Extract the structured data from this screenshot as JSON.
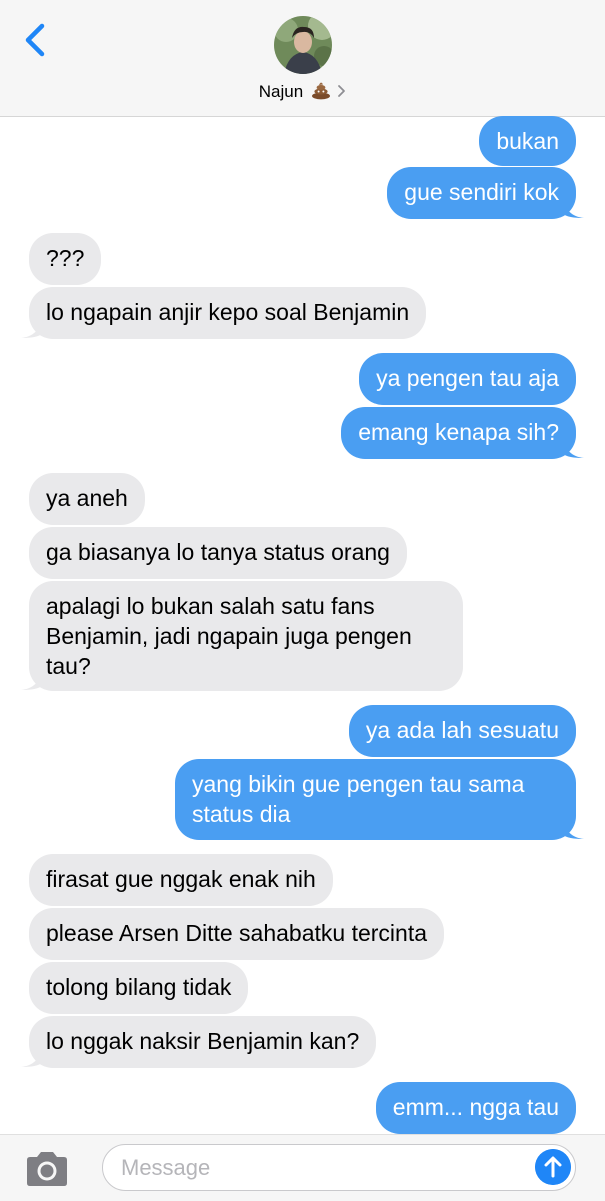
{
  "header": {
    "contact_name": "Najun",
    "contact_emoji": "pile-of-poo-icon"
  },
  "messages": [
    {
      "dir": "out",
      "text": "bukan"
    },
    {
      "dir": "out",
      "text": "gue sendiri kok"
    },
    {
      "dir": "in",
      "text": "???"
    },
    {
      "dir": "in",
      "text": "lo ngapain anjir kepo soal Benjamin"
    },
    {
      "dir": "out",
      "text": "ya pengen tau aja"
    },
    {
      "dir": "out",
      "text": "emang kenapa sih?"
    },
    {
      "dir": "in",
      "text": "ya aneh"
    },
    {
      "dir": "in",
      "text": "ga biasanya lo tanya status orang"
    },
    {
      "dir": "in",
      "text": "apalagi lo bukan salah satu fans Benjamin, jadi ngapain juga pengen tau?"
    },
    {
      "dir": "out",
      "text": "ya ada lah sesuatu"
    },
    {
      "dir": "out",
      "text": "yang bikin gue pengen tau sama status dia"
    },
    {
      "dir": "in",
      "text": "firasat gue nggak enak nih"
    },
    {
      "dir": "in",
      "text": "please Arsen Ditte sahabatku tercinta"
    },
    {
      "dir": "in",
      "text": "tolong bilang tidak"
    },
    {
      "dir": "in",
      "text": "lo nggak naksir Benjamin kan?"
    },
    {
      "dir": "out",
      "text": "emm... ngga tau"
    }
  ],
  "input": {
    "placeholder": "Message"
  },
  "colors": {
    "outgoing_bubble": "#4a9ef2",
    "incoming_bubble": "#e9e9eb",
    "accent": "#1f86f7"
  }
}
